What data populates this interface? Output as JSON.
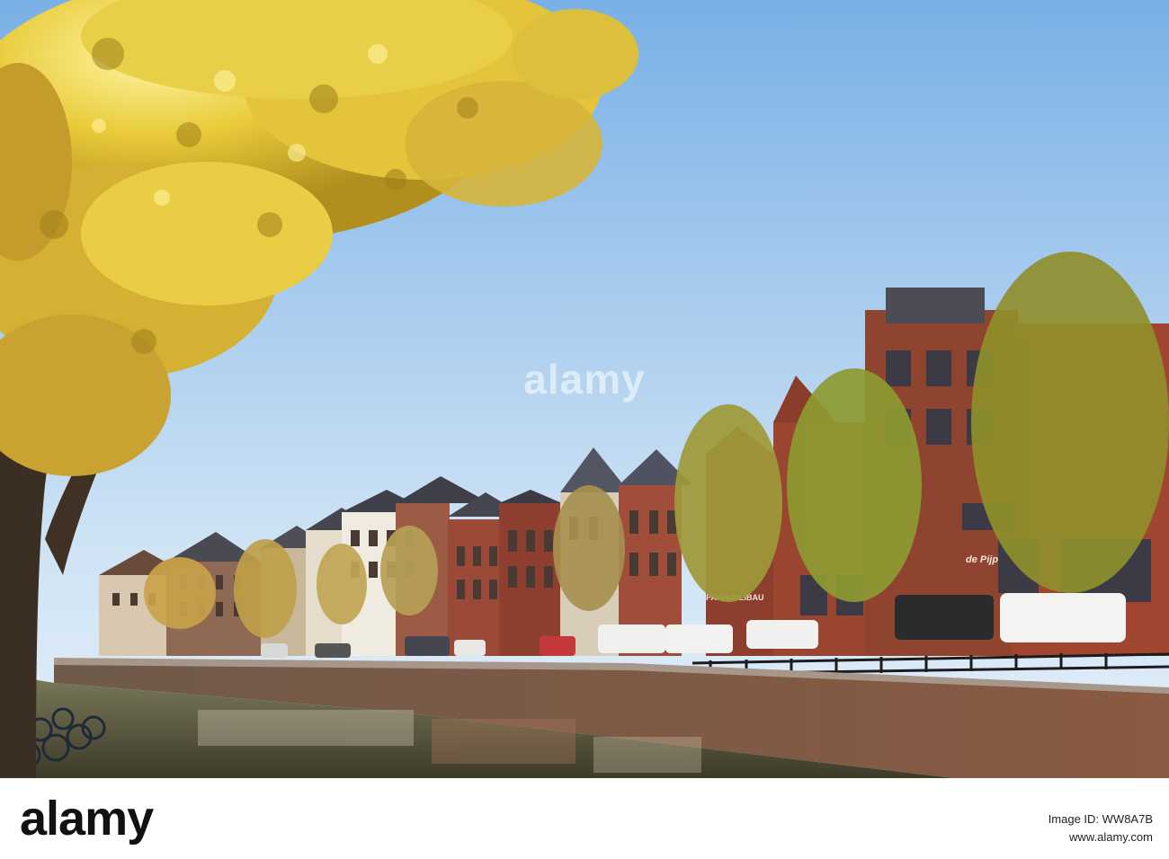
{
  "watermark": "alamy",
  "signs": {
    "pakhuis": "PAKHUS",
    "libau": "LIBAU",
    "cafe": "de Pijp"
  },
  "footer": {
    "logo": "alamy",
    "image_id": "Image ID: WW8A7B",
    "url": "www.alamy.com"
  },
  "colors": {
    "sky_top": "#7fb4e6",
    "sky_bottom": "#d8eaf6",
    "foliage": "#e6c632",
    "brick": "#8a3e2a",
    "water": "#5f5a3e"
  }
}
